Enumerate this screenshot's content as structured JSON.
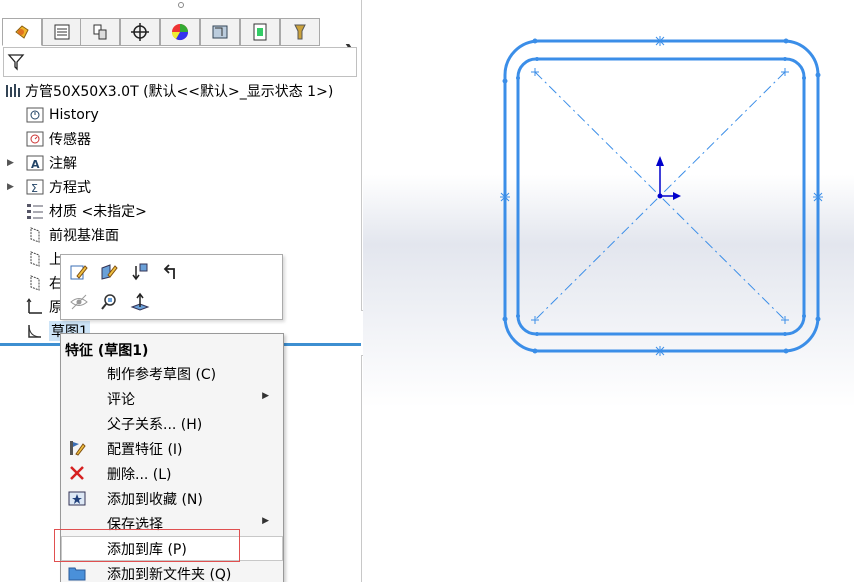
{
  "tabs": [
    {
      "name": "featuremanager",
      "icon": "feature-manager-icon"
    },
    {
      "name": "propertymanager",
      "icon": "property-manager-icon"
    },
    {
      "name": "configurationmanager",
      "icon": "configuration-manager-icon"
    },
    {
      "name": "dimxpertmanager",
      "icon": "dimxpert-icon"
    },
    {
      "name": "displaymanager",
      "icon": "display-manager-icon"
    },
    {
      "name": "cam",
      "icon": "cam-icon"
    },
    {
      "name": "document",
      "icon": "document-icon"
    },
    {
      "name": "tools",
      "icon": "tools-icon"
    }
  ],
  "tab_next": "❯",
  "tree": {
    "root": "方管50X50X3.0T  (默认<<默认>_显示状态 1>)",
    "items": [
      {
        "label": "History",
        "icon": "history-icon",
        "expandable": false
      },
      {
        "label": "传感器",
        "icon": "sensor-icon",
        "expandable": false
      },
      {
        "label": "注解",
        "icon": "annotation-icon",
        "expandable": true
      },
      {
        "label": "方程式",
        "icon": "equation-icon",
        "expandable": true
      },
      {
        "label": "材质 <未指定>",
        "icon": "material-icon",
        "expandable": false
      },
      {
        "label": "前视基准面",
        "icon": "plane-icon",
        "expandable": false
      },
      {
        "label": "上",
        "icon": "plane-icon",
        "expandable": false
      },
      {
        "label": "右",
        "icon": "plane-icon",
        "expandable": false
      },
      {
        "label": "原",
        "icon": "origin-icon",
        "expandable": false
      },
      {
        "label": "草图1",
        "icon": "sketch-icon",
        "expandable": false
      }
    ]
  },
  "context_menu": {
    "title": "特征 (草图1)",
    "items": [
      {
        "label": "制作参考草图 (C)",
        "icon": "",
        "submenu": false
      },
      {
        "label": "评论",
        "icon": "",
        "submenu": true
      },
      {
        "label": "父子关系... (H)",
        "icon": "",
        "submenu": false
      },
      {
        "label": "配置特征 (I)",
        "icon": "configure-feature-icon",
        "submenu": false
      },
      {
        "label": "删除... (L)",
        "icon": "delete-icon",
        "submenu": false
      },
      {
        "label": "添加到收藏 (N)",
        "icon": "favorite-icon",
        "submenu": false
      },
      {
        "label": "保存选择",
        "icon": "",
        "submenu": true
      },
      {
        "label": "添加到库 (P)",
        "icon": "",
        "submenu": false
      },
      {
        "label": "添加到新文件夹 (Q)",
        "icon": "folder-icon",
        "submenu": false
      }
    ],
    "submenu_arrow": "▶"
  },
  "colors": {
    "sketch_line": "#3b8ee8",
    "highlight": "#e05050",
    "selection_bar": "#3d8fd1"
  }
}
